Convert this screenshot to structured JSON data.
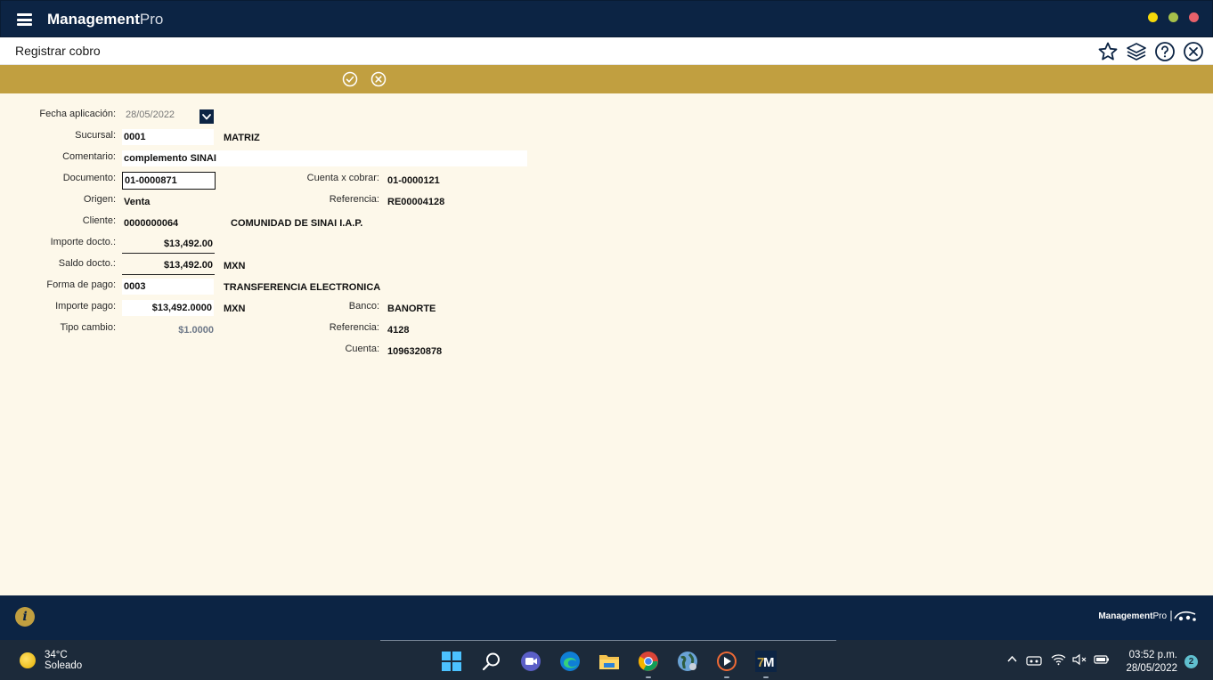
{
  "app": {
    "brand_main": "Management",
    "brand_pro": "Pro",
    "window_buttons": {
      "minimize_color": "#f5d90a",
      "maximize_color": "#a6c04a",
      "close_color": "#e8616b"
    }
  },
  "titlebar": {
    "title": "Registrar cobro",
    "icons": [
      "star-icon",
      "layers-icon",
      "help-icon",
      "close-circle-icon"
    ]
  },
  "toolbar": {
    "icons": [
      "check-circle-icon",
      "cancel-circle-icon"
    ],
    "accent": "#c19f40"
  },
  "form": {
    "fecha": {
      "label": "Fecha aplicación:",
      "value": "28/05/2022"
    },
    "sucursal": {
      "label": "Sucursal:",
      "code": "0001",
      "name": "MATRIZ"
    },
    "comentario": {
      "label": "Comentario:",
      "value": "complemento SINAI"
    },
    "documento": {
      "label": "Documento:",
      "value": "01-0000871"
    },
    "cuenta_x_cobrar": {
      "label": "Cuenta x cobrar:",
      "value": "01-0000121"
    },
    "origen": {
      "label": "Origen:",
      "value": "Venta"
    },
    "referencia1": {
      "label": "Referencia:",
      "value": "RE00004128"
    },
    "cliente": {
      "label": "Cliente:",
      "code": "0000000064",
      "name": "COMUNIDAD DE SINAI I.A.P."
    },
    "importe_docto": {
      "label": "Importe docto.:",
      "value": "$13,492.00"
    },
    "saldo_docto": {
      "label": "Saldo docto.:",
      "value": "$13,492.00",
      "currency": "MXN"
    },
    "forma_pago": {
      "label": "Forma de pago:",
      "code": "0003",
      "name": "TRANSFERENCIA ELECTRONICA"
    },
    "importe_pago": {
      "label": "Importe pago:",
      "value": "$13,492.0000",
      "currency": "MXN"
    },
    "banco": {
      "label": "Banco:",
      "value": "BANORTE"
    },
    "tipo_cambio": {
      "label": "Tipo cambio:",
      "value": "$1.0000"
    },
    "referencia2": {
      "label": "Referencia:",
      "value": "4128"
    },
    "cuenta": {
      "label": "Cuenta:",
      "value": "1096320878"
    }
  },
  "footer": {
    "brand_main": "Management",
    "brand_pro": "Pro"
  },
  "taskbar": {
    "weather_temp": "34°C",
    "weather_desc": "Soleado",
    "time": "03:52 p.m.",
    "date": "28/05/2022",
    "notifications": "2",
    "apps": [
      "windows-start-icon",
      "search-icon",
      "teams-icon",
      "edge-icon",
      "file-explorer-icon",
      "chrome-icon",
      "globe-icon",
      "media-player-icon",
      "management-pro-icon"
    ]
  }
}
